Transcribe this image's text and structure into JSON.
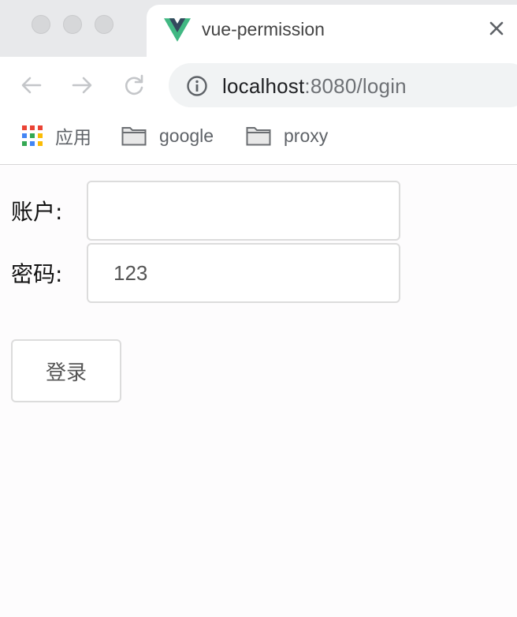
{
  "browser": {
    "tab": {
      "title": "vue-permission",
      "favicon": "vue-logo-icon"
    },
    "address_bar": {
      "host": "localhost",
      "rest": ":8080/login"
    },
    "bookmarks": [
      {
        "label": "应用",
        "icon": "apps-grid-icon"
      },
      {
        "label": "google",
        "icon": "folder-icon"
      },
      {
        "label": "proxy",
        "icon": "folder-icon"
      }
    ]
  },
  "form": {
    "account_label": "账户:",
    "account_value": "",
    "password_label": "密码:",
    "password_value": "123",
    "login_button": "登录"
  },
  "colors": {
    "vue_green": "#41b883",
    "vue_dark": "#35495e",
    "input_border": "#dcdcdc"
  }
}
